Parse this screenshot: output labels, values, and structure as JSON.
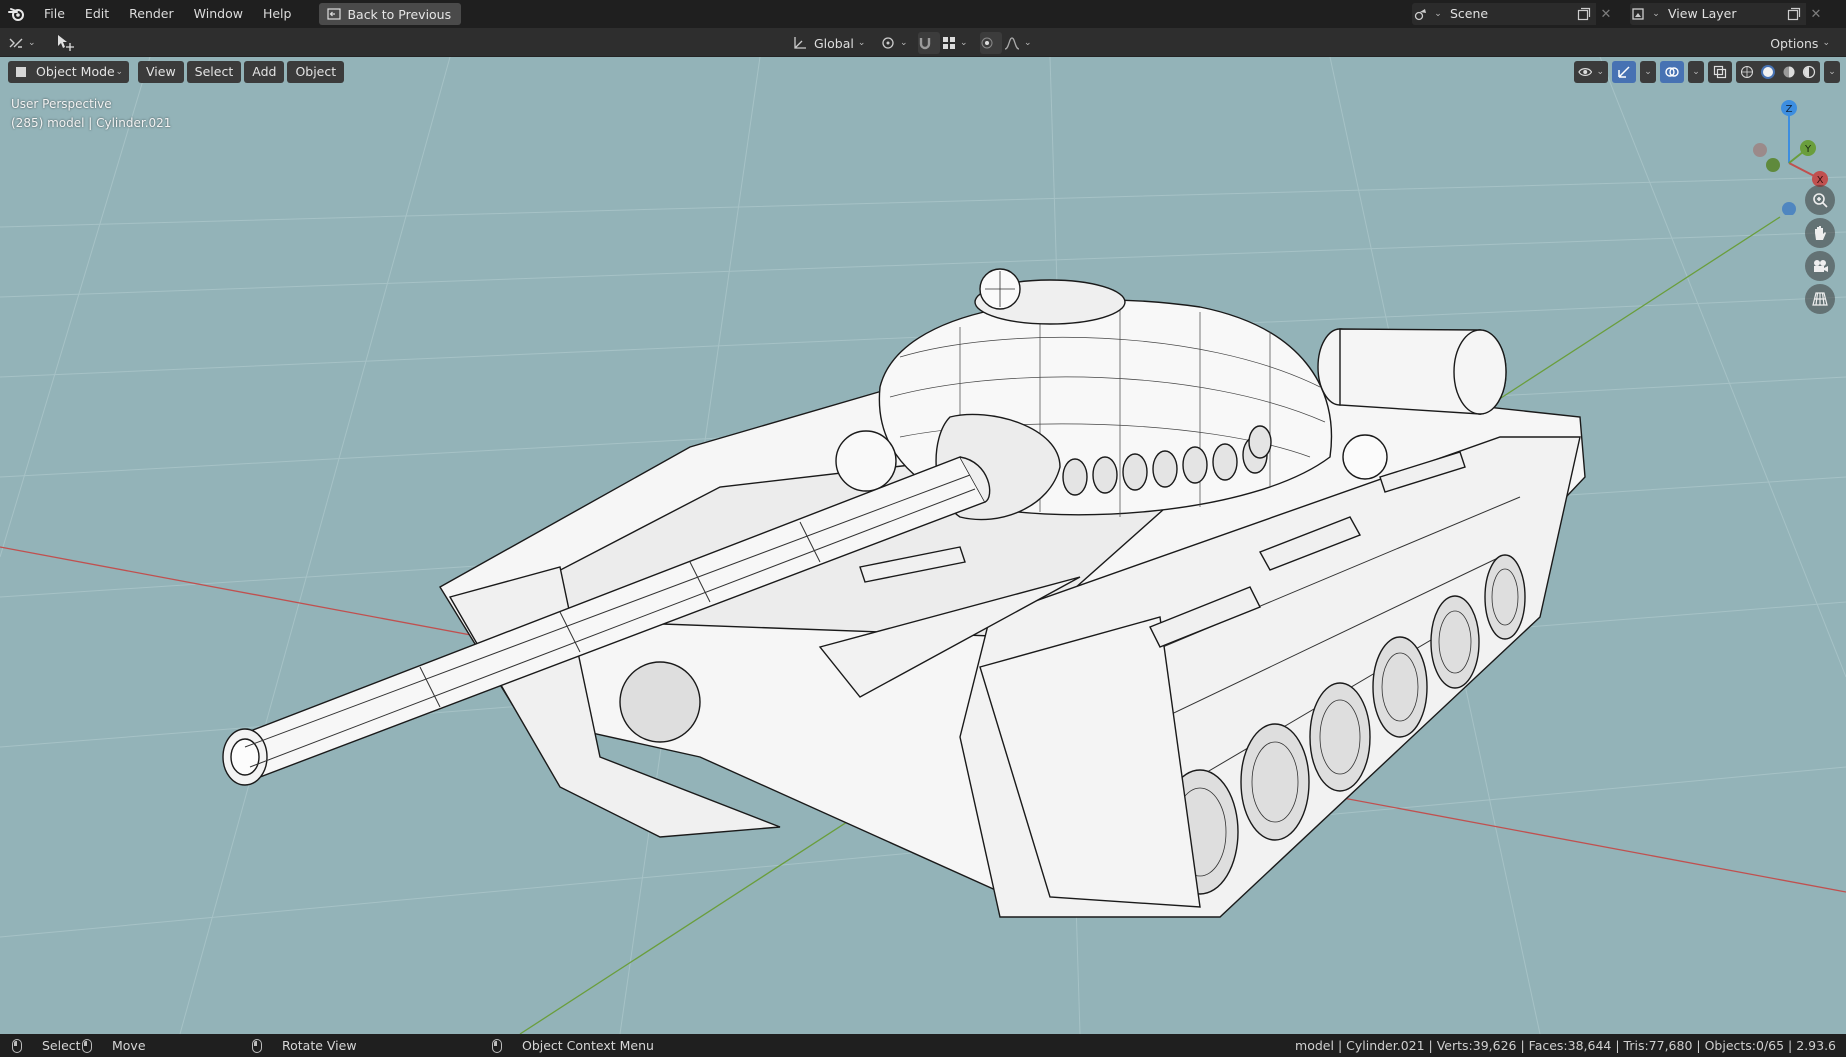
{
  "menu": {
    "items": [
      "File",
      "Edit",
      "Render",
      "Window",
      "Help"
    ],
    "back_button": "Back to Previous"
  },
  "scene": {
    "name": "Scene",
    "view_layer": "View Layer"
  },
  "toolbar": {
    "transform_orientation": "Global",
    "options": "Options"
  },
  "viewport": {
    "mode": "Object Mode",
    "menus": [
      "View",
      "Select",
      "Add",
      "Object"
    ],
    "perspective_label": "User Perspective",
    "object_label": "(285) model | Cylinder.021",
    "gizmo_axes": {
      "z": "Z",
      "y": "Y",
      "x": "X"
    },
    "colors": {
      "background": "#93b3b8",
      "x_axis": "#c0504f",
      "y_axis": "#6a9e3c",
      "z_axis": "#3d8ee0",
      "active_button": "#4772b3"
    }
  },
  "statusbar": {
    "select": "Select",
    "move": "Move",
    "rotate": "Rotate View",
    "context_menu": "Object Context Menu",
    "stats": "model | Cylinder.021 | Verts:39,626 | Faces:38,644 | Tris:77,680 | Objects:0/65 | 2.93.6"
  }
}
